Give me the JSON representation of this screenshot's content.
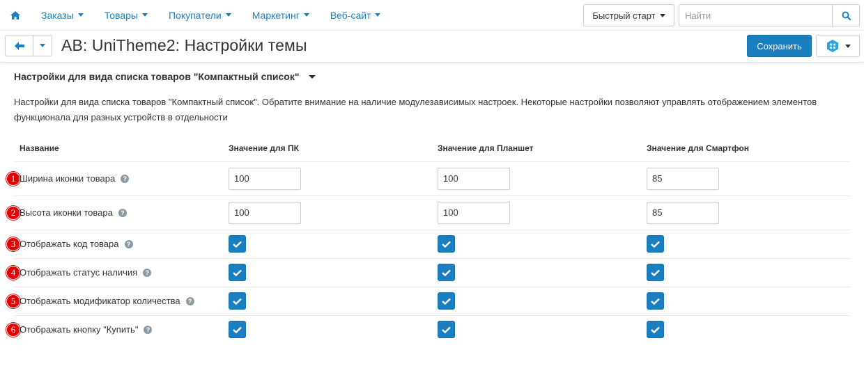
{
  "nav": {
    "menu": [
      {
        "label": "Заказы"
      },
      {
        "label": "Товары"
      },
      {
        "label": "Покупатели"
      },
      {
        "label": "Маркетинг"
      },
      {
        "label": "Веб-сайт"
      }
    ],
    "quick_start": "Быстрый старт",
    "search_placeholder": "Найти"
  },
  "header": {
    "title": "AB: UniTheme2: Настройки темы",
    "save_label": "Сохранить"
  },
  "section": {
    "title": "Настройки для вида списка товаров \"Компактный список\"",
    "description": "Настройки для вида списка товаров \"Компактный список\". Обратите внимание на наличие модулезависимых настроек. Некоторые настройки позволяют управлять отображением элементов функционала для разных устройств в отдельности"
  },
  "table": {
    "headers": {
      "name": "Название",
      "pc": "Значение для ПК",
      "tablet": "Значение для Планшет",
      "phone": "Значение для Смартфон"
    },
    "rows": [
      {
        "badge": "1",
        "label": "Ширина иконки товара",
        "type": "input",
        "pc": "100",
        "tablet": "100",
        "phone": "85"
      },
      {
        "badge": "2",
        "label": "Высота иконки товара",
        "type": "input",
        "pc": "100",
        "tablet": "100",
        "phone": "85"
      },
      {
        "badge": "3",
        "label": "Отображать код товара",
        "type": "checkbox",
        "pc": true,
        "tablet": true,
        "phone": true
      },
      {
        "badge": "4",
        "label": "Отображать статус наличия",
        "type": "checkbox",
        "pc": true,
        "tablet": true,
        "phone": true
      },
      {
        "badge": "5",
        "label": "Отображать модификатор количества",
        "type": "checkbox",
        "pc": true,
        "tablet": true,
        "phone": true
      },
      {
        "badge": "6",
        "label": "Отображать кнопку \"Купить\"",
        "type": "checkbox",
        "pc": true,
        "tablet": true,
        "phone": true
      }
    ]
  },
  "colors": {
    "accent": "#1a7fc1",
    "badge": "#e00000"
  }
}
